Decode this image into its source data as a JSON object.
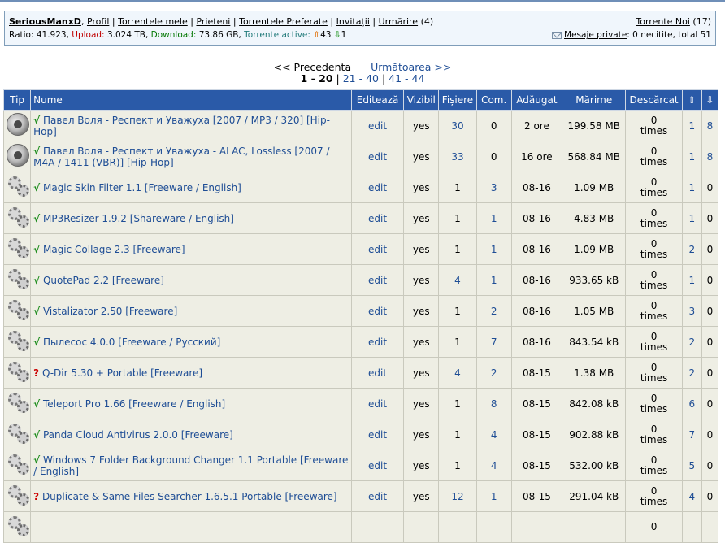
{
  "user": {
    "username": "SeriousManxD",
    "links": [
      "Profil",
      "Torrentele mele",
      "Prieteni",
      "Torrentele Preferate",
      "Invitații",
      "Urmărire"
    ],
    "watch_count": "(4)",
    "ratio_label": "Ratio:",
    "ratio_value": "41.923,",
    "upload_label": "Upload:",
    "upload_value": "3.024 TB,",
    "download_label": "Download:",
    "download_value": "73.86 GB,",
    "active_label": "Torrente active:",
    "active_up": "43",
    "active_down": "1",
    "new_torrents_label": "Torrente Noi",
    "new_torrents_count": "(17)",
    "pm_label": "Mesaje private",
    "pm_status": ": 0 necitite, total 51"
  },
  "pager": {
    "prev": "<< Precedenta",
    "next": "Următoarea >>",
    "current": "1 - 20",
    "pages": [
      "21 - 40",
      "41 - 44"
    ]
  },
  "table": {
    "headers": [
      "Tip",
      "Nume",
      "Editează",
      "Vizibil",
      "Fișiere",
      "Com.",
      "Adăugat",
      "Mărime",
      "Descărcat"
    ],
    "up_arrow": "⇧",
    "down_arrow": "⇩",
    "rows": [
      {
        "icon": "speaker-icon",
        "status": "√",
        "name": "Павел Воля - Респект и Уважуха [2007 / MP3 / 320] [Hip-Hop]",
        "edit": "edit",
        "visible": "yes",
        "files": "30",
        "files_link": true,
        "comments": "0",
        "comments_link": false,
        "added": "2 ore",
        "size": "199.58 MB",
        "downloaded": "0",
        "times": "times",
        "seeders": "1",
        "leechers": "8",
        "leechers_link": true
      },
      {
        "icon": "speaker-icon",
        "status": "√",
        "name": "Павел Воля - Респект и Уважуха - ALAC, Lossless [2007 / M4A / 1411 (VBR)] [Hip-Hop]",
        "edit": "edit",
        "visible": "yes",
        "files": "33",
        "files_link": true,
        "comments": "0",
        "comments_link": false,
        "added": "16 ore",
        "size": "568.84 MB",
        "downloaded": "0",
        "times": "times",
        "seeders": "1",
        "leechers": "8",
        "leechers_link": true
      },
      {
        "icon": "gears-icon",
        "status": "√",
        "name": "Magic Skin Filter 1.1 [Freeware / English]",
        "edit": "edit",
        "visible": "yes",
        "files": "1",
        "files_link": false,
        "comments": "3",
        "comments_link": true,
        "added": "08-16",
        "size": "1.09 MB",
        "downloaded": "0",
        "times": "times",
        "seeders": "1",
        "leechers": "0",
        "leechers_link": false
      },
      {
        "icon": "gears-icon",
        "status": "√",
        "name": "MP3Resizer 1.9.2 [Shareware / English]",
        "edit": "edit",
        "visible": "yes",
        "files": "1",
        "files_link": false,
        "comments": "1",
        "comments_link": true,
        "added": "08-16",
        "size": "4.83 MB",
        "downloaded": "0",
        "times": "times",
        "seeders": "1",
        "leechers": "0",
        "leechers_link": false
      },
      {
        "icon": "gears-icon",
        "status": "√",
        "name": "Magic Collage 2.3 [Freeware]",
        "edit": "edit",
        "visible": "yes",
        "files": "1",
        "files_link": false,
        "comments": "1",
        "comments_link": true,
        "added": "08-16",
        "size": "1.09 MB",
        "downloaded": "0",
        "times": "times",
        "seeders": "2",
        "leechers": "0",
        "leechers_link": false
      },
      {
        "icon": "gears-icon",
        "status": "√",
        "name": "QuotePad 2.2 [Freeware]",
        "edit": "edit",
        "visible": "yes",
        "files": "4",
        "files_link": true,
        "comments": "1",
        "comments_link": true,
        "added": "08-16",
        "size": "933.65 kB",
        "downloaded": "0",
        "times": "times",
        "seeders": "1",
        "leechers": "0",
        "leechers_link": false
      },
      {
        "icon": "gears-icon",
        "status": "√",
        "name": "Vistalizator 2.50 [Freeware]",
        "edit": "edit",
        "visible": "yes",
        "files": "1",
        "files_link": false,
        "comments": "2",
        "comments_link": true,
        "added": "08-16",
        "size": "1.05 MB",
        "downloaded": "0",
        "times": "times",
        "seeders": "3",
        "leechers": "0",
        "leechers_link": false
      },
      {
        "icon": "gears-icon",
        "status": "√",
        "name": "Пылесос 4.0.0 [Freeware / Русский]",
        "edit": "edit",
        "visible": "yes",
        "files": "1",
        "files_link": false,
        "comments": "7",
        "comments_link": true,
        "added": "08-16",
        "size": "843.54 kB",
        "downloaded": "0",
        "times": "times",
        "seeders": "2",
        "leechers": "0",
        "leechers_link": false
      },
      {
        "icon": "gears-icon",
        "status": "?",
        "name": "Q-Dir 5.30 + Portable [Freeware]",
        "edit": "edit",
        "visible": "yes",
        "files": "4",
        "files_link": true,
        "comments": "2",
        "comments_link": true,
        "added": "08-15",
        "size": "1.38 MB",
        "downloaded": "0",
        "times": "times",
        "seeders": "2",
        "leechers": "0",
        "leechers_link": false
      },
      {
        "icon": "gears-icon",
        "status": "√",
        "name": "Teleport Pro 1.66 [Freeware / English]",
        "edit": "edit",
        "visible": "yes",
        "files": "1",
        "files_link": false,
        "comments": "8",
        "comments_link": true,
        "added": "08-15",
        "size": "842.08 kB",
        "downloaded": "0",
        "times": "times",
        "seeders": "6",
        "leechers": "0",
        "leechers_link": false
      },
      {
        "icon": "gears-icon",
        "status": "√",
        "name": "Panda Cloud Antivirus 2.0.0 [Freeware]",
        "edit": "edit",
        "visible": "yes",
        "files": "1",
        "files_link": false,
        "comments": "4",
        "comments_link": true,
        "added": "08-15",
        "size": "902.88 kB",
        "downloaded": "0",
        "times": "times",
        "seeders": "7",
        "leechers": "0",
        "leechers_link": false
      },
      {
        "icon": "gears-icon",
        "status": "√",
        "name": "Windows 7 Folder Background Changer 1.1 Portable [Freeware / English]",
        "edit": "edit",
        "visible": "yes",
        "files": "1",
        "files_link": false,
        "comments": "4",
        "comments_link": true,
        "added": "08-15",
        "size": "532.00 kB",
        "downloaded": "0",
        "times": "times",
        "seeders": "5",
        "leechers": "0",
        "leechers_link": false
      },
      {
        "icon": "gears-icon",
        "status": "?",
        "name": "Duplicate & Same Files Searcher 1.6.5.1 Portable [Freeware]",
        "edit": "edit",
        "visible": "yes",
        "files": "12",
        "files_link": true,
        "comments": "1",
        "comments_link": true,
        "added": "08-15",
        "size": "291.04 kB",
        "downloaded": "0",
        "times": "times",
        "seeders": "4",
        "leechers": "0",
        "leechers_link": false
      },
      {
        "icon": "gears-icon",
        "status": "",
        "name": "",
        "edit": "",
        "visible": "",
        "files": "",
        "files_link": false,
        "comments": "",
        "comments_link": false,
        "added": "",
        "size": "",
        "downloaded": "0",
        "times": "",
        "seeders": "",
        "leechers": "",
        "leechers_link": false
      }
    ]
  }
}
